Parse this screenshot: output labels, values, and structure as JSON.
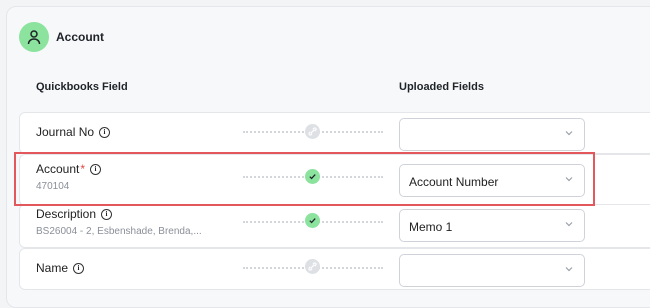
{
  "section": {
    "title": "Account",
    "icon": "user-icon"
  },
  "columns": {
    "quickbooks_field": "Quickbooks Field",
    "uploaded_fields": "Uploaded Fields"
  },
  "rows": [
    {
      "label": "Journal No",
      "required": false,
      "sample": "",
      "status": "unmapped",
      "mapped_value": ""
    },
    {
      "label": "Account",
      "required": true,
      "required_mark": "*",
      "sample": "470104",
      "status": "mapped",
      "mapped_value": "Account Number"
    },
    {
      "label": "Description",
      "required": false,
      "sample": "BS26004 - 2, Esbenshade, Brenda,...",
      "status": "mapped",
      "mapped_value": "Memo 1"
    },
    {
      "label": "Name",
      "required": false,
      "sample": "",
      "status": "unmapped",
      "mapped_value": ""
    }
  ],
  "colors": {
    "success": "#8be39e",
    "highlight": "#e2585c",
    "required": "#e04646"
  }
}
